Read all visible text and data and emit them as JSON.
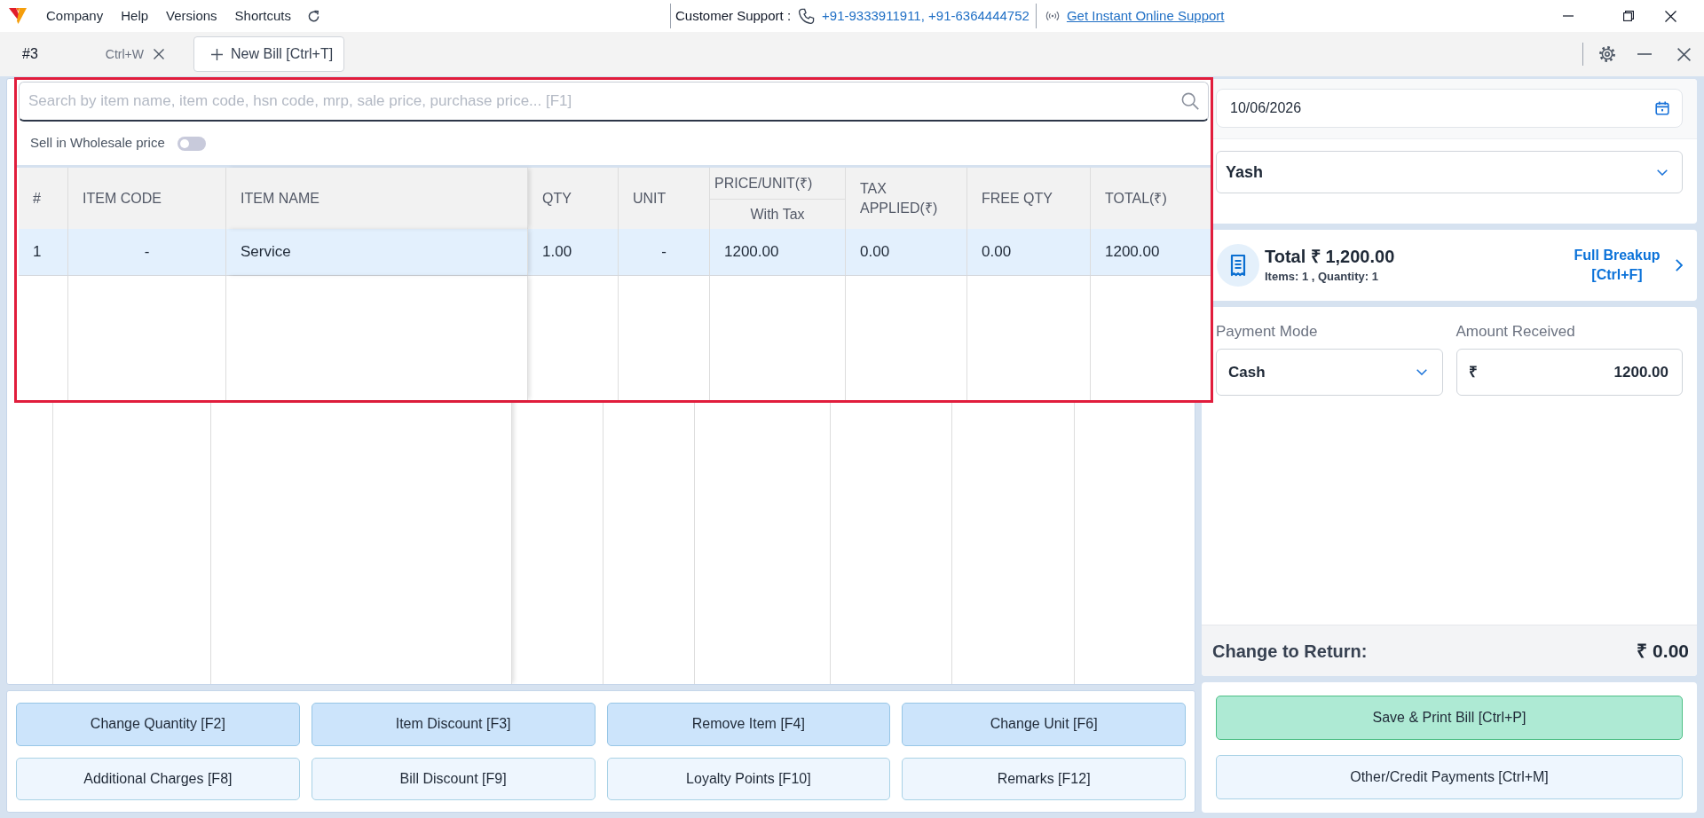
{
  "title_bar": {
    "menu": [
      {
        "label": "Company"
      },
      {
        "label": "Help"
      },
      {
        "label": "Versions"
      },
      {
        "label": "Shortcuts"
      }
    ],
    "support_label": "Customer Support :",
    "support_phones": "+91-9333911911, +91-6364444752",
    "support_link": "Get Instant Online Support"
  },
  "tabs": [
    {
      "label": "#3",
      "shortcut": "Ctrl+W",
      "selected": true
    }
  ],
  "new_bill_button": "New Bill [Ctrl+T]",
  "item_search": {
    "placeholder": "Search by item name, item code, hsn code, mrp, sale price, purchase price... [F1]"
  },
  "wholesale_price": {
    "label": "Sell in Wholesale price",
    "on": false
  },
  "table": {
    "columns": [
      {
        "label": "#"
      },
      {
        "label": "ITEM CODE"
      },
      {
        "label": "ITEM NAME"
      },
      {
        "label": "QTY"
      },
      {
        "label": "UNIT"
      },
      {
        "label": "PRICE/UNIT(₹)",
        "sublabel": "With Tax"
      },
      {
        "label": "TAX APPLIED(₹)"
      },
      {
        "label": "FREE QTY"
      },
      {
        "label": "TOTAL(₹)"
      }
    ],
    "rows": [
      {
        "selected": true,
        "cells": [
          "1",
          "-",
          "Service",
          "1.00",
          "-",
          "1200.00",
          "0.00",
          "0.00",
          "1200.00"
        ]
      }
    ]
  },
  "actions": [
    {
      "label": "Change Quantity [F2]",
      "kind": "primary"
    },
    {
      "label": "Item Discount [F3]",
      "kind": "primary"
    },
    {
      "label": "Remove Item [F4]",
      "kind": "primary"
    },
    {
      "label": "Change Unit [F6]",
      "kind": "primary"
    },
    {
      "label": "Additional Charges [F8]",
      "kind": "secondary"
    },
    {
      "label": "Bill Discount [F9]",
      "kind": "secondary"
    },
    {
      "label": "Loyalty Points [F10]",
      "kind": "secondary"
    },
    {
      "label": "Remarks [F12]",
      "kind": "secondary"
    }
  ],
  "bill": {
    "date": "10/06/2026",
    "customer": "Yash",
    "total": "Total ₹ 1,200.00",
    "summary": "Items: 1 , Quantity: 1",
    "breakup_link": "Full Breakup [Ctrl+F]"
  },
  "payment": {
    "mode_label": "Payment Mode",
    "mode": "Cash",
    "amount_label": "Amount Received",
    "currency": "₹",
    "amount": "1200.00"
  },
  "change": {
    "label": "Change to Return:",
    "value": "₹ 0.00"
  },
  "checkout": [
    {
      "label": "Save & Print Bill [Ctrl+P]",
      "kind": "success"
    },
    {
      "label": "Other/Credit Payments [Ctrl+M]",
      "kind": "secondary"
    }
  ]
}
